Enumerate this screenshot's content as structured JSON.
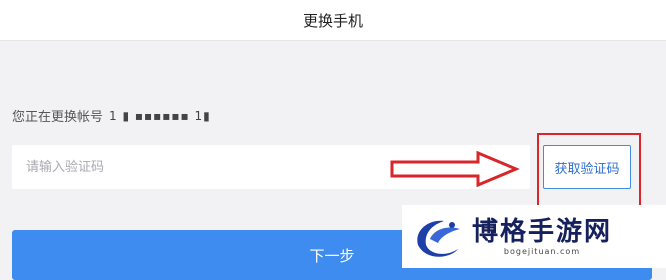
{
  "header": {
    "title": "更换手机"
  },
  "account": {
    "label": "您正在更换帐号",
    "masked_number": "1 ▮ ▪▪▪▪▪▪ 1▮"
  },
  "code_input": {
    "placeholder": "请输入验证码",
    "value": ""
  },
  "get_code_button": {
    "label": "获取验证码"
  },
  "next_button": {
    "label": "下一步"
  },
  "annotation": {
    "arrow_color": "#d8262b",
    "highlight_color": "#d8262b"
  },
  "watermark": {
    "title": "博格手游网",
    "url": "bogejituan.com"
  },
  "colors": {
    "accent": "#3f8cf0",
    "page_bg": "#f2f2f4"
  }
}
